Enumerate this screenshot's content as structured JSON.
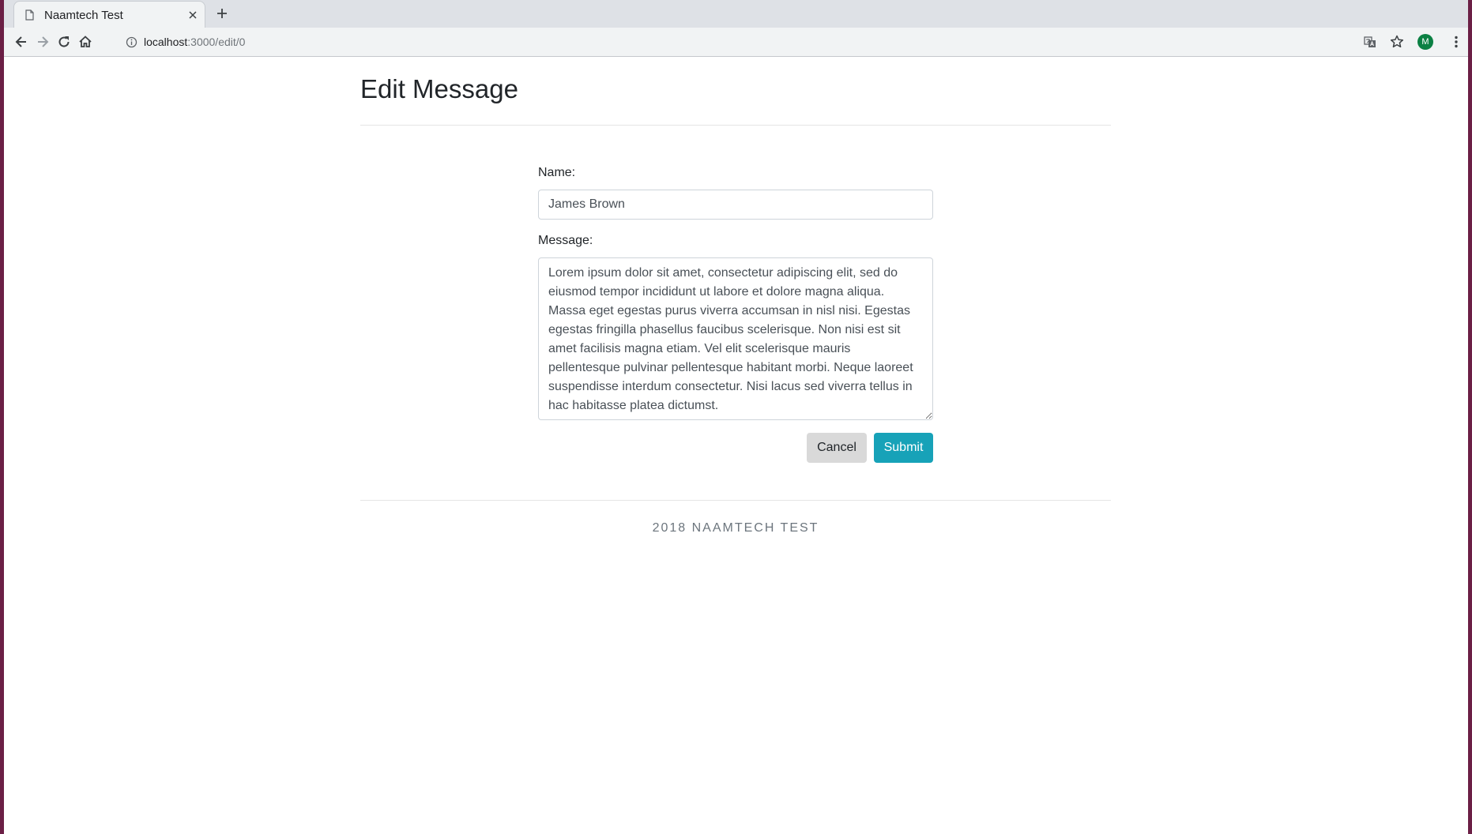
{
  "browser": {
    "tab_title": "Naamtech Test",
    "url_host": "localhost",
    "url_rest": ":3000/edit/0",
    "avatar_letter": "M"
  },
  "page": {
    "title": "Edit Message"
  },
  "form": {
    "name_label": "Name:",
    "name_value": "James Brown",
    "message_label": "Message:",
    "message_value": "Lorem ipsum dolor sit amet, consectetur adipiscing elit, sed do eiusmod tempor incididunt ut labore et dolore magna aliqua. Massa eget egestas purus viverra accumsan in nisl nisi. Egestas egestas fringilla phasellus faucibus scelerisque. Non nisi est sit amet facilisis magna etiam. Vel elit scelerisque mauris pellentesque pulvinar pellentesque habitant morbi. Neque laoreet suspendisse interdum consectetur. Nisi lacus sed viverra tellus in hac habitasse platea dictumst.",
    "cancel_label": "Cancel",
    "submit_label": "Submit"
  },
  "footer": {
    "text": "2018 NAAMTECH TEST"
  },
  "colors": {
    "submit": "#17a2b8",
    "cancel": "#d9d9d9",
    "desktop": "#6b1f45"
  },
  "icons": {
    "tab_favicon": "document-icon",
    "tab_close": "close-icon",
    "new_tab": "plus-icon",
    "back": "arrow-left-icon",
    "forward": "arrow-right-icon",
    "reload": "reload-icon",
    "home": "home-icon",
    "site_info": "info-icon",
    "translate": "translate-icon",
    "bookmark": "star-icon",
    "menu": "kebab-menu-icon"
  }
}
